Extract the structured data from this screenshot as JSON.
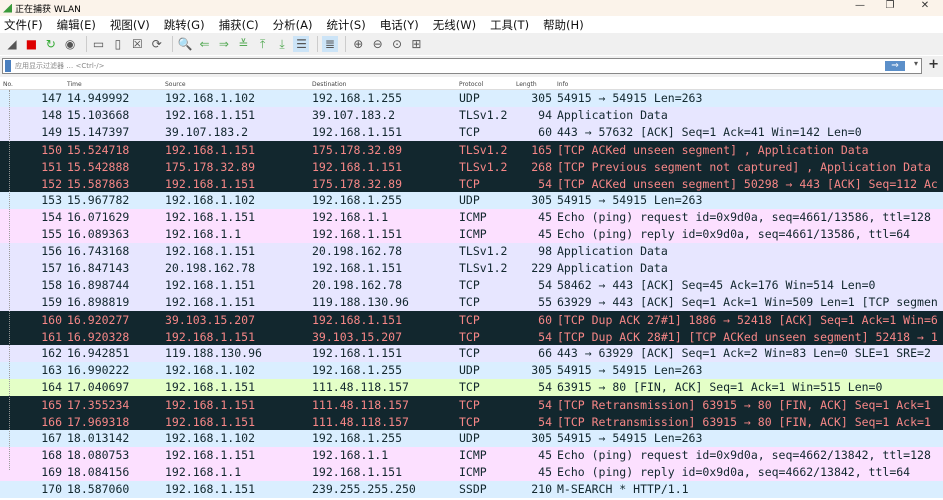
{
  "window": {
    "title": "正在捕获 WLAN",
    "minimize": "—",
    "maximize": "❐",
    "close": "✕"
  },
  "menu": [
    "文件(F)",
    "编辑(E)",
    "视图(V)",
    "跳转(G)",
    "捕获(C)",
    "分析(A)",
    "统计(S)",
    "电话(Y)",
    "无线(W)",
    "工具(T)",
    "帮助(H)"
  ],
  "filter": {
    "placeholder": "应用显示过滤器 … <Ctrl-/>",
    "apply": "⇒",
    "dropdown": "▾",
    "add": "+"
  },
  "columns": [
    "No.",
    "Time",
    "Source",
    "Destination",
    "Protocol",
    "Length",
    "Info"
  ],
  "colors": {
    "udp": "#daeeff",
    "tcp": "#e7e6ff",
    "icmp": "#fce0ff",
    "bad_bg": "#12272e",
    "bad_fg": "#f78787",
    "fin": "#e4ffc7"
  },
  "packets": [
    {
      "no": "147",
      "time": "14.949992",
      "src": "192.168.1.102",
      "dst": "192.168.1.255",
      "proto": "UDP",
      "len": "305",
      "info": "54915 → 54915 Len=263",
      "cls": "udp"
    },
    {
      "no": "148",
      "time": "15.103668",
      "src": "192.168.1.151",
      "dst": "39.107.183.2",
      "proto": "TLSv1.2",
      "len": "94",
      "info": "Application Data",
      "cls": "tcp"
    },
    {
      "no": "149",
      "time": "15.147397",
      "src": "39.107.183.2",
      "dst": "192.168.1.151",
      "proto": "TCP",
      "len": "60",
      "info": "443 → 57632 [ACK] Seq=1 Ack=41 Win=142 Len=0",
      "cls": "tcp"
    },
    {
      "no": "150",
      "time": "15.524718",
      "src": "192.168.1.151",
      "dst": "175.178.32.89",
      "proto": "TLSv1.2",
      "len": "165",
      "info": "[TCP ACKed unseen segment] , Application Data",
      "cls": "bad"
    },
    {
      "no": "151",
      "time": "15.542888",
      "src": "175.178.32.89",
      "dst": "192.168.1.151",
      "proto": "TLSv1.2",
      "len": "268",
      "info": "[TCP Previous segment not captured] , Application Data",
      "cls": "bad"
    },
    {
      "no": "152",
      "time": "15.587863",
      "src": "192.168.1.151",
      "dst": "175.178.32.89",
      "proto": "TCP",
      "len": "54",
      "info": "[TCP ACKed unseen segment] 50298 → 443 [ACK] Seq=112 Ac",
      "cls": "bad"
    },
    {
      "no": "153",
      "time": "15.967782",
      "src": "192.168.1.102",
      "dst": "192.168.1.255",
      "proto": "UDP",
      "len": "305",
      "info": "54915 → 54915 Len=263",
      "cls": "udp"
    },
    {
      "no": "154",
      "time": "16.071629",
      "src": "192.168.1.151",
      "dst": "192.168.1.1",
      "proto": "ICMP",
      "len": "45",
      "info": "Echo (ping) request  id=0x9d0a, seq=4661/13586, ttl=128",
      "cls": "icmp"
    },
    {
      "no": "155",
      "time": "16.089363",
      "src": "192.168.1.1",
      "dst": "192.168.1.151",
      "proto": "ICMP",
      "len": "45",
      "info": "Echo (ping) reply    id=0x9d0a, seq=4661/13586, ttl=64",
      "cls": "icmp"
    },
    {
      "no": "156",
      "time": "16.743168",
      "src": "192.168.1.151",
      "dst": "20.198.162.78",
      "proto": "TLSv1.2",
      "len": "98",
      "info": "Application Data",
      "cls": "tcp"
    },
    {
      "no": "157",
      "time": "16.847143",
      "src": "20.198.162.78",
      "dst": "192.168.1.151",
      "proto": "TLSv1.2",
      "len": "229",
      "info": "Application Data",
      "cls": "tcp"
    },
    {
      "no": "158",
      "time": "16.898744",
      "src": "192.168.1.151",
      "dst": "20.198.162.78",
      "proto": "TCP",
      "len": "54",
      "info": "58462 → 443 [ACK] Seq=45 Ack=176 Win=514 Len=0",
      "cls": "tcp"
    },
    {
      "no": "159",
      "time": "16.898819",
      "src": "192.168.1.151",
      "dst": "119.188.130.96",
      "proto": "TCP",
      "len": "55",
      "info": "63929 → 443 [ACK] Seq=1 Ack=1 Win=509 Len=1 [TCP segmen",
      "cls": "tcp"
    },
    {
      "no": "160",
      "time": "16.920277",
      "src": "39.103.15.207",
      "dst": "192.168.1.151",
      "proto": "TCP",
      "len": "60",
      "info": "[TCP Dup ACK 27#1] 1886 → 52418 [ACK] Seq=1 Ack=1 Win=6",
      "cls": "bad"
    },
    {
      "no": "161",
      "time": "16.920328",
      "src": "192.168.1.151",
      "dst": "39.103.15.207",
      "proto": "TCP",
      "len": "54",
      "info": "[TCP Dup ACK 28#1] [TCP ACKed unseen segment] 52418 → 1",
      "cls": "bad"
    },
    {
      "no": "162",
      "time": "16.942851",
      "src": "119.188.130.96",
      "dst": "192.168.1.151",
      "proto": "TCP",
      "len": "66",
      "info": "443 → 63929 [ACK] Seq=1 Ack=2 Win=83 Len=0 SLE=1 SRE=2",
      "cls": "tcp"
    },
    {
      "no": "163",
      "time": "16.990222",
      "src": "192.168.1.102",
      "dst": "192.168.1.255",
      "proto": "UDP",
      "len": "305",
      "info": "54915 → 54915 Len=263",
      "cls": "udp"
    },
    {
      "no": "164",
      "time": "17.040697",
      "src": "192.168.1.151",
      "dst": "111.48.118.157",
      "proto": "TCP",
      "len": "54",
      "info": "63915 → 80 [FIN, ACK] Seq=1 Ack=1 Win=515 Len=0",
      "cls": "fin"
    },
    {
      "no": "165",
      "time": "17.355234",
      "src": "192.168.1.151",
      "dst": "111.48.118.157",
      "proto": "TCP",
      "len": "54",
      "info": "[TCP Retransmission] 63915 → 80 [FIN, ACK] Seq=1 Ack=1",
      "cls": "bad"
    },
    {
      "no": "166",
      "time": "17.969318",
      "src": "192.168.1.151",
      "dst": "111.48.118.157",
      "proto": "TCP",
      "len": "54",
      "info": "[TCP Retransmission] 63915 → 80 [FIN, ACK] Seq=1 Ack=1",
      "cls": "bad"
    },
    {
      "no": "167",
      "time": "18.013142",
      "src": "192.168.1.102",
      "dst": "192.168.1.255",
      "proto": "UDP",
      "len": "305",
      "info": "54915 → 54915 Len=263",
      "cls": "udp"
    },
    {
      "no": "168",
      "time": "18.080753",
      "src": "192.168.1.151",
      "dst": "192.168.1.1",
      "proto": "ICMP",
      "len": "45",
      "info": "Echo (ping) request  id=0x9d0a, seq=4662/13842, ttl=128",
      "cls": "icmp"
    },
    {
      "no": "169",
      "time": "18.084156",
      "src": "192.168.1.1",
      "dst": "192.168.1.151",
      "proto": "ICMP",
      "len": "45",
      "info": "Echo (ping) reply    id=0x9d0a, seq=4662/13842, ttl=64",
      "cls": "icmp"
    },
    {
      "no": "170",
      "time": "18.587060",
      "src": "192.168.1.151",
      "dst": "239.255.255.250",
      "proto": "SSDP",
      "len": "210",
      "info": "M-SEARCH * HTTP/1.1",
      "cls": "ssdp"
    }
  ],
  "toolbar": [
    {
      "icon": "shark-fin-icon",
      "g": "◢"
    },
    {
      "icon": "stop-capture-icon",
      "g": "■"
    },
    {
      "icon": "restart-capture-icon",
      "g": "↻"
    },
    {
      "icon": "capture-options-icon",
      "g": "◉"
    },
    {
      "sep": true
    },
    {
      "icon": "open-file-icon",
      "g": "▭"
    },
    {
      "icon": "save-file-icon",
      "g": "▯"
    },
    {
      "icon": "close-file-icon",
      "g": "☒"
    },
    {
      "icon": "reload-icon",
      "g": "⟳"
    },
    {
      "sep": true
    },
    {
      "icon": "find-packet-icon",
      "g": "🔍"
    },
    {
      "icon": "go-back-icon",
      "g": "⇐"
    },
    {
      "icon": "go-forward-icon",
      "g": "⇒"
    },
    {
      "icon": "go-to-packet-icon",
      "g": "≚"
    },
    {
      "icon": "go-first-icon",
      "g": "⤒"
    },
    {
      "icon": "go-last-icon",
      "g": "⤓"
    },
    {
      "icon": "auto-scroll-icon",
      "g": "☰",
      "sel": true
    },
    {
      "sep": true
    },
    {
      "icon": "colorize-icon",
      "g": "≣",
      "sel": true
    },
    {
      "sep": true
    },
    {
      "icon": "zoom-in-icon",
      "g": "⊕"
    },
    {
      "icon": "zoom-out-icon",
      "g": "⊖"
    },
    {
      "icon": "zoom-reset-icon",
      "g": "⊙"
    },
    {
      "icon": "resize-columns-icon",
      "g": "⊞"
    }
  ]
}
